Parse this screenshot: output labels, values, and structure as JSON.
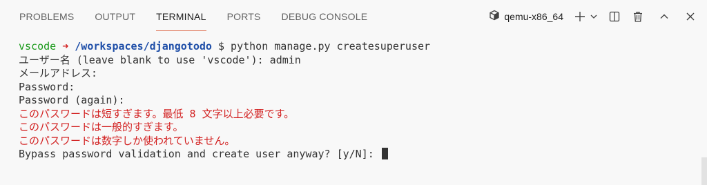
{
  "tabs": [
    {
      "label": "PROBLEMS"
    },
    {
      "label": "OUTPUT"
    },
    {
      "label": "TERMINAL"
    },
    {
      "label": "PORTS"
    },
    {
      "label": "DEBUG CONSOLE"
    }
  ],
  "active_tab": "TERMINAL",
  "actions": {
    "profile_label": "qemu-x86_64",
    "icons": [
      "box-icon",
      "plus-icon",
      "chevron-down-icon",
      "split-icon",
      "trash-icon",
      "chevron-up-icon",
      "close-icon"
    ]
  },
  "terminal": {
    "prompt_user": "vscode",
    "prompt_arrow": "➜",
    "prompt_path": "/workspaces/djangotodo",
    "prompt_rest": " $ python manage.py createsuperuser",
    "lines": [
      "ユーザー名 (leave blank to use 'vscode'): admin",
      "メールアドレス:",
      "Password:",
      "Password (again):"
    ],
    "errors": [
      "このパスワードは短すぎます。最低 8 文字以上必要です。",
      "このパスワードは一般的すぎます。",
      "このパスワードは数字しか使われていません。"
    ],
    "last_line": "Bypass password validation and create user anyway? [y/N]: "
  },
  "colors": {
    "background": "#f8f8f8",
    "prompt_user": "#1a9a1a",
    "prompt_arrow": "#d21f1f",
    "prompt_path": "#1e4ea8",
    "error_text": "#d21f1f",
    "active_tab_underline": "#e07a5f"
  }
}
